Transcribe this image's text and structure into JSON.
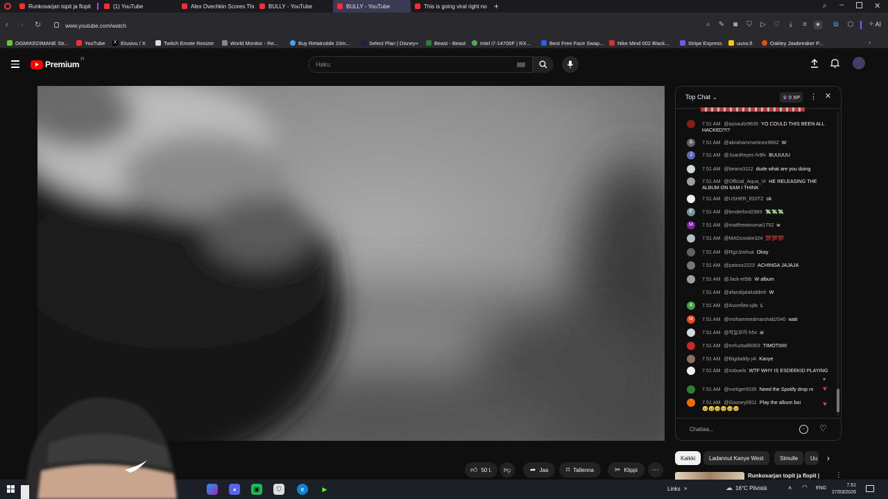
{
  "browser": {
    "tabs": [
      {
        "title": "Runkosarjan topit ja flopit",
        "color": "#ff2d2d"
      },
      {
        "title": "(1) YouTube",
        "color": "#ff2d2d"
      },
      {
        "title": "Alex Ovechkin Scores Thr",
        "color": "#ff2d2d"
      },
      {
        "title": "BULLY - YouTube",
        "color": "#ff2d2d"
      },
      {
        "title": "BULLY - YouTube",
        "color": "#ff2d2d"
      },
      {
        "title": "This is going viral right no",
        "color": "#ff2d2d"
      }
    ],
    "url": "www.youtube.com/watch",
    "bookmarks": [
      "OGMIKEDIMANE Str...",
      "YouTube",
      "Etusivu / X",
      "Twitch Emote Resizer",
      "World Monitor - Re...",
      "Buy Retatrutide 10m...",
      "Select Plan | Disney+",
      "Beast - Beast",
      "Intel i7-14700F | RX...",
      "Best Free Face Swap...",
      "Nike Mind 002 Black...",
      "Stripe Express",
      "uuno.fi",
      "Oakley Jawbreaker P..."
    ],
    "ai_label": "AI"
  },
  "youtube": {
    "brand": "Premium",
    "region": "FI",
    "search_placeholder": "Haku"
  },
  "chat": {
    "header_title": "Top Chat",
    "xp_label": "0 XP",
    "input_placeholder": "Chattaa...",
    "messages": [
      {
        "time": "7.51 AM",
        "author": "@assaultz9635",
        "text": "YO COULD THIS BEEN ALL HACKED?!?",
        "avatar": "",
        "avatar_color": "#8b1b1b"
      },
      {
        "time": "7.51 AM",
        "author": "@abrahammartinez9662",
        "text": "W",
        "avatar": "A",
        "avatar_color": "#5f6368"
      },
      {
        "time": "7.51 AM",
        "author": "@JuanReyes-fv9fv",
        "text": "BUUUUU",
        "avatar": "J",
        "avatar_color": "#5c6bc0"
      },
      {
        "time": "7.51 AM",
        "author": "@beans3112",
        "text": "dude what are you doing",
        "avatar": "",
        "avatar_color": "#cfd8dc"
      },
      {
        "time": "7.51 AM",
        "author": "@Official_Aqua_Vr",
        "text": "HE RELEASING THE ALBUM ON 6AM I THINK",
        "avatar": "",
        "avatar_color": "#9e9e9e"
      },
      {
        "time": "7.51 AM",
        "author": "@USHER_EDITZ",
        "text": "ok",
        "avatar": "",
        "avatar_color": "#eeeeee"
      },
      {
        "time": "7.51 AM",
        "author": "@lenderlord2983",
        "text": "💸💸💸",
        "avatar": "E",
        "avatar_color": "#78909c"
      },
      {
        "time": "7.51 AM",
        "author": "@matthewtoumai1752",
        "text": "w",
        "avatar": "M",
        "avatar_color": "#7b1fa2"
      },
      {
        "time": "7.51 AM",
        "author": "@MADcookie324",
        "text": "💯💯💯",
        "avatar": "",
        "avatar_color": "#b0bec5"
      },
      {
        "time": "7.51 AM",
        "author": "@RgzJoshua",
        "text": "Okay",
        "avatar": "",
        "avatar_color": "#616161"
      },
      {
        "time": "7.51 AM",
        "author": "@patoxx2223",
        "text": "ACHINGA JAJAJA",
        "avatar": "",
        "avatar_color": "#757575"
      },
      {
        "time": "7.51 AM",
        "author": "@Jack-ei5tb",
        "text": "W album",
        "avatar": "",
        "avatar_color": "#9e9e9e"
      },
      {
        "time": "7.51 AM",
        "author": "@afandijalaluddinh",
        "text": "W",
        "avatar": "",
        "avatar_color": "#111111"
      },
      {
        "time": "7.51 AM",
        "author": "@Асилбек-ц8к",
        "text": "L",
        "avatar": "A",
        "avatar_color": "#43a047"
      },
      {
        "time": "7.51 AM",
        "author": "@mohammedmarshab2040",
        "text": "wait",
        "avatar": "M",
        "avatar_color": "#e64a19"
      },
      {
        "time": "7.51 AM",
        "author": "@하늘보리-h5x",
        "text": "ai",
        "avatar": "",
        "avatar_color": "#cfd8dc"
      },
      {
        "time": "7.51 AM",
        "author": "@mrfuzball9363",
        "text": "TIMOTIIIIII",
        "avatar": "",
        "avatar_color": "#c62828"
      },
      {
        "time": "7.51 AM",
        "author": "@Bigdaddy-j4i",
        "text": "Kanye",
        "avatar": "",
        "avatar_color": "#8d6e63"
      },
      {
        "time": "7.51 AM",
        "author": "@zobuels",
        "text": "WTF WHY IS ESDEEKID PLAYING",
        "avatar": "",
        "avatar_color": "#eeeeee"
      },
      {
        "time": "7.51 AM",
        "author": "@vortiger5035",
        "text": "Need the Spotify drop rn",
        "avatar": "",
        "avatar_color": "#2e7d32"
      },
      {
        "time": "7.51 AM",
        "author": "@Goosey0911",
        "text": "Play the album boi",
        "avatar": "",
        "avatar_color": "#ef6c00"
      }
    ],
    "last_emojis": "🥹🥹🥹🥹🥹🥹"
  },
  "chips": [
    "Kaikki",
    "Ladannut Kanye West",
    "Simulle",
    "Uu"
  ],
  "actions": {
    "like_count": "50 t.",
    "share": "Jaa",
    "save": "Tallenna",
    "clip": "Klippi"
  },
  "recommendation": {
    "title": "Runkosarjan topit ja flopit |"
  },
  "taskbar": {
    "links": "Links",
    "weather": "16°C  Pilvistä",
    "lang": "ENG",
    "time": "7.51",
    "date": "27/03/2026"
  }
}
